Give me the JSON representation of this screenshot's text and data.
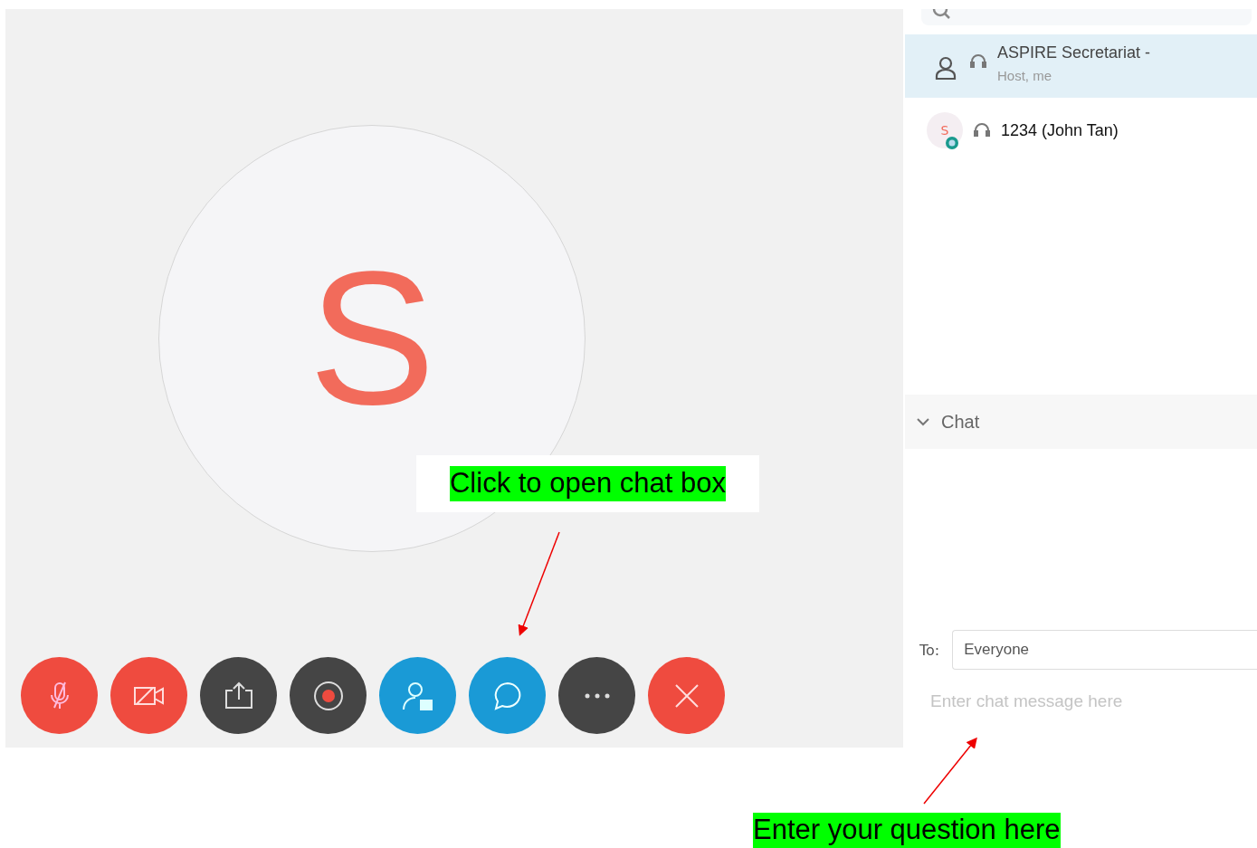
{
  "stage": {
    "avatar_initial": "S",
    "controls": [
      {
        "kind": "mic-off",
        "color": "#ef4b3f"
      },
      {
        "kind": "video-off",
        "color": "#ef4b3f"
      },
      {
        "kind": "share",
        "color": "#454545"
      },
      {
        "kind": "record",
        "color": "#454545"
      },
      {
        "kind": "participants",
        "color": "#1a9ad6"
      },
      {
        "kind": "chat",
        "color": "#1a9ad6"
      },
      {
        "kind": "more",
        "color": "#454545"
      },
      {
        "kind": "end",
        "color": "#ef4b3f"
      }
    ]
  },
  "participants": [
    {
      "kind": "host",
      "name": "ASPIRE Secretariat -",
      "role": "Host, me",
      "selected": true
    },
    {
      "kind": "guest",
      "avatar_initial": "S",
      "name": "1234 (John Tan)",
      "selected": false
    }
  ],
  "chat": {
    "title": "Chat",
    "expanded": true,
    "to_label": "To:",
    "to_value": "Everyone",
    "placeholder": "Enter chat message here"
  },
  "annotations": [
    {
      "text": "Click to open chat box"
    },
    {
      "text": "Enter your question here"
    }
  ]
}
